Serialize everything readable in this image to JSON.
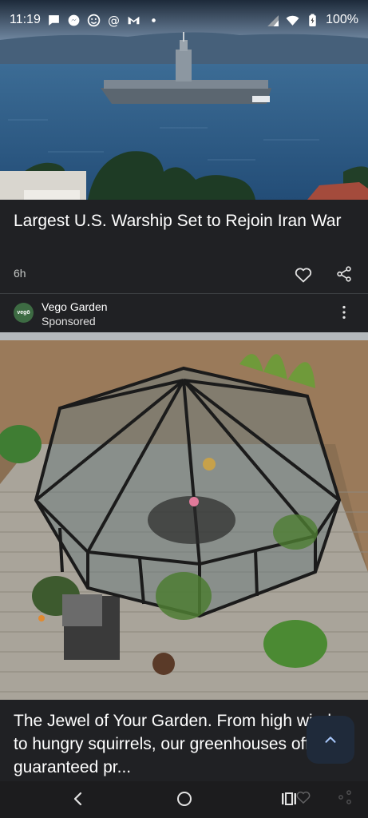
{
  "status_bar": {
    "time": "11:19",
    "left_icons": [
      "chat-bubble-icon",
      "messenger-icon",
      "emoji-face-icon",
      "threads-icon",
      "gmail-icon",
      "dot-icon"
    ],
    "right_icons": [
      "vibrate-icon",
      "signal-icon",
      "wifi-icon",
      "battery-charging-icon"
    ],
    "battery": "100%"
  },
  "article": {
    "title": "Largest U.S. Warship Set to Rejoin Iran War",
    "age": "6h",
    "actions": [
      "heart-icon",
      "share-icon"
    ]
  },
  "sponsor": {
    "logo_text": "vegō",
    "name": "Vego Garden",
    "tag": "Sponsored"
  },
  "ad": {
    "text": "The Jewel of Your Garden. From high winds to hungry squirrels, our greenhouses offer guaranteed pr..."
  },
  "colors": {
    "background": "#202124",
    "sponsor_logo": "#3d6b43",
    "scroll_button": "#1f2a3a",
    "sea": "#2d5b86"
  }
}
